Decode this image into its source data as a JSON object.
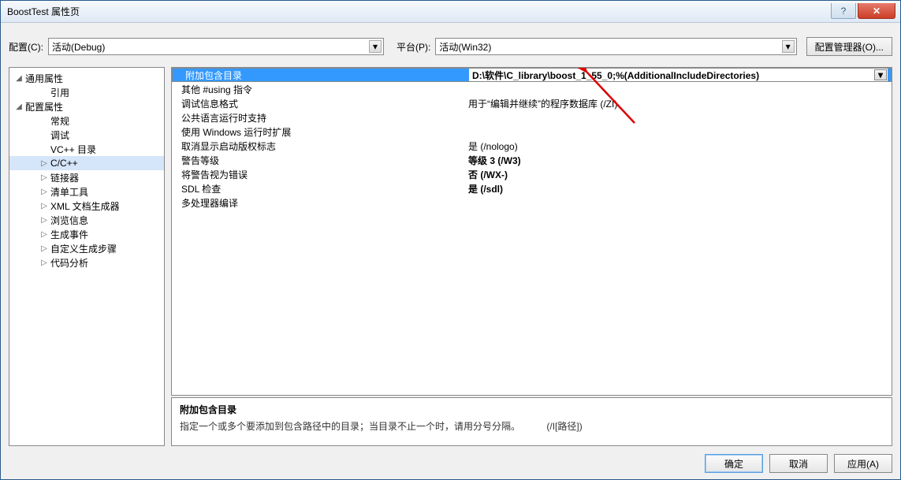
{
  "titlebar": {
    "text": "BoostTest 属性页"
  },
  "toprow": {
    "config_label": "配置(C):",
    "config_value": "活动(Debug)",
    "platform_label": "平台(P):",
    "platform_value": "活动(Win32)",
    "manager_btn": "配置管理器(O)..."
  },
  "tree": [
    {
      "label": "通用属性",
      "ind": 0,
      "tw": "◢"
    },
    {
      "label": "引用",
      "ind": 2,
      "tw": ""
    },
    {
      "label": "配置属性",
      "ind": 0,
      "tw": "◢"
    },
    {
      "label": "常规",
      "ind": 2,
      "tw": ""
    },
    {
      "label": "调试",
      "ind": 2,
      "tw": ""
    },
    {
      "label": "VC++ 目录",
      "ind": 2,
      "tw": ""
    },
    {
      "label": "C/C++",
      "ind": 2,
      "tw": "▷",
      "selected": true
    },
    {
      "label": "链接器",
      "ind": 2,
      "tw": "▷"
    },
    {
      "label": "清单工具",
      "ind": 2,
      "tw": "▷"
    },
    {
      "label": "XML 文档生成器",
      "ind": 2,
      "tw": "▷"
    },
    {
      "label": "浏览信息",
      "ind": 2,
      "tw": "▷"
    },
    {
      "label": "生成事件",
      "ind": 2,
      "tw": "▷"
    },
    {
      "label": "自定义生成步骤",
      "ind": 2,
      "tw": "▷"
    },
    {
      "label": "代码分析",
      "ind": 2,
      "tw": "▷"
    }
  ],
  "grid": [
    {
      "k": "附加包含目录",
      "v": "D:\\软件\\C_library\\boost_1_55_0;%(AdditionalIncludeDirectories)",
      "selected": true,
      "bold": true
    },
    {
      "k": "其他 #using 指令",
      "v": ""
    },
    {
      "k": "调试信息格式",
      "v": "用于“编辑并继续”的程序数据库 (/ZI)"
    },
    {
      "k": "公共语言运行时支持",
      "v": ""
    },
    {
      "k": "使用 Windows 运行时扩展",
      "v": ""
    },
    {
      "k": "取消显示启动版权标志",
      "v": "是 (/nologo)"
    },
    {
      "k": "警告等级",
      "v": "等级 3 (/W3)",
      "bold": true
    },
    {
      "k": "将警告视为错误",
      "v": "否 (/WX-)",
      "bold": true
    },
    {
      "k": "SDL 检查",
      "v": "是 (/sdl)",
      "bold": true
    },
    {
      "k": "多处理器编译",
      "v": ""
    }
  ],
  "desc": {
    "title": "附加包含目录",
    "body": "指定一个或多个要添加到包含路径中的目录；当目录不止一个时，请用分号分隔。",
    "flag": "(/I[路径])"
  },
  "buttons": {
    "ok": "确定",
    "cancel": "取消",
    "apply": "应用(A)"
  }
}
